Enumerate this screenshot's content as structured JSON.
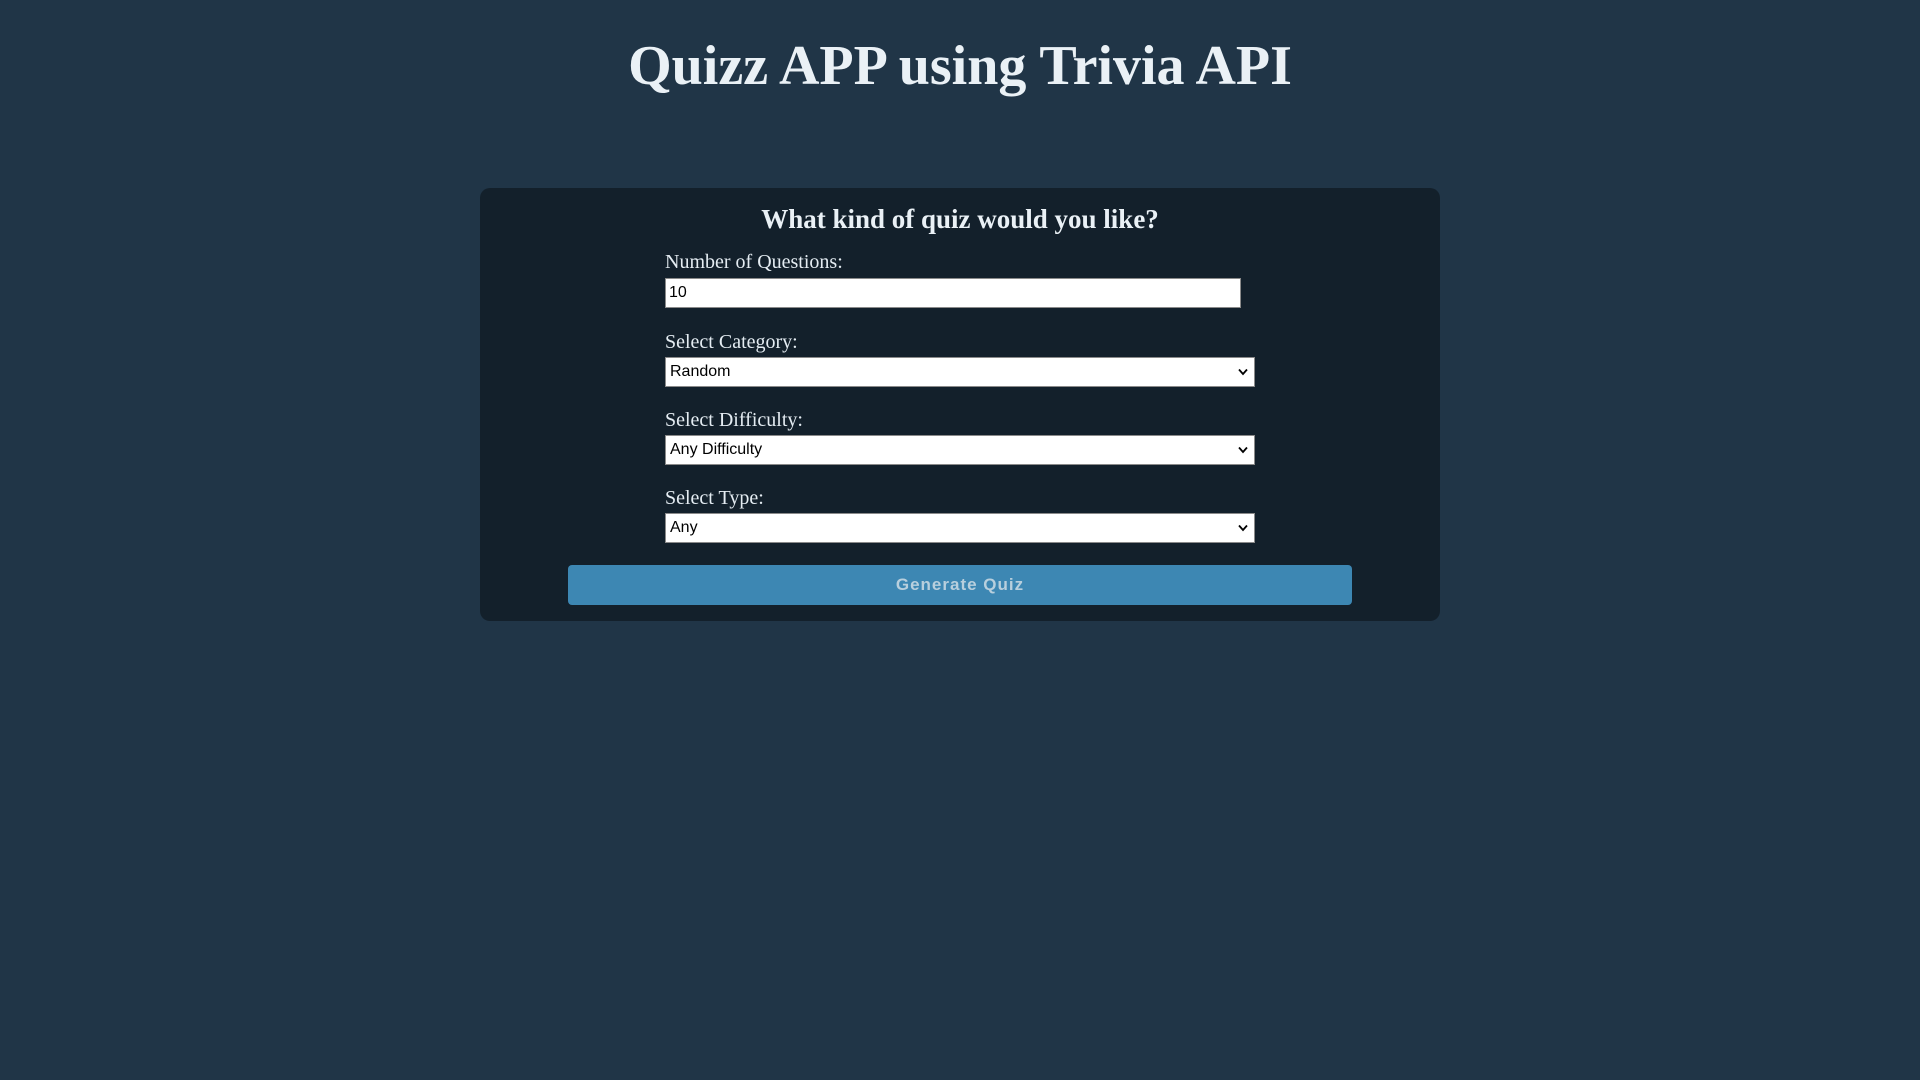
{
  "header": {
    "title": "Quizz APP using Trivia API"
  },
  "form": {
    "heading": "What kind of quiz would you like?",
    "number_of_questions": {
      "label": "Number of Questions:",
      "value": "10"
    },
    "category": {
      "label": "Select Category:",
      "selected": "Random"
    },
    "difficulty": {
      "label": "Select Difficulty:",
      "selected": "Any Difficulty"
    },
    "type": {
      "label": "Select Type:",
      "selected": "Any"
    },
    "submit_label": "Generate Quiz"
  },
  "colors": {
    "page_background": "#203547",
    "panel_background": "#13202b",
    "button_background": "#3d87b3",
    "button_text": "#b8cfdd",
    "heading_text": "#eaf1f6"
  },
  "icons": {
    "select_chevron": "chevron-down-icon"
  }
}
